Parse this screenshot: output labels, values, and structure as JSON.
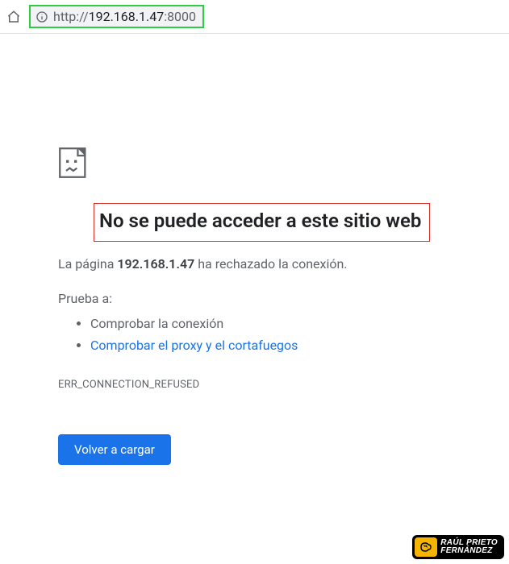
{
  "url": {
    "scheme": "http://",
    "host": "192.168.1.47",
    "port": ":8000"
  },
  "error": {
    "title": "No se puede acceder a este sitio web",
    "desc_prefix": "La página ",
    "desc_host": "192.168.1.47",
    "desc_suffix": " ha rechazado la conexión.",
    "try_label": "Prueba a:",
    "suggestions": [
      {
        "text": "Comprobar la conexión",
        "link": false
      },
      {
        "text": "Comprobar el proxy y el cortafuegos",
        "link": true
      }
    ],
    "code": "ERR_CONNECTION_REFUSED",
    "reload_label": "Volver a cargar"
  },
  "watermark": {
    "line1": "RAÚL PRIETO",
    "line2": "FERNÁNDEZ"
  }
}
